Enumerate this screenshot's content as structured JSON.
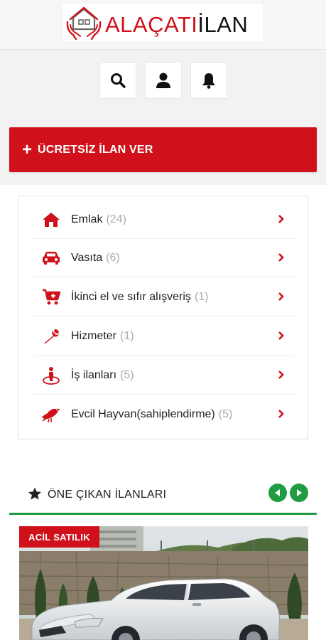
{
  "brand": {
    "part1": "ALAÇATI",
    "part2": "İLAN",
    "color_red": "#d0111b",
    "color_dark": "#111111"
  },
  "top_icons": [
    "search-icon",
    "user-icon",
    "bell-icon"
  ],
  "cta": {
    "label": "ÜCRETSİZ İLAN VER",
    "icon": "plus-icon",
    "color": "#d0111b"
  },
  "categories": [
    {
      "name": "Emlak",
      "count": "(24)",
      "icon": "home-icon"
    },
    {
      "name": "Vasıta",
      "count": "(6)",
      "icon": "car-icon"
    },
    {
      "name": "İkinci el ve sıfır alışveriş",
      "count": "(1)",
      "icon": "cart-icon"
    },
    {
      "name": "Hizmeter",
      "count": "(1)",
      "icon": "wrench-icon"
    },
    {
      "name": "İş ilanları",
      "count": "(5)",
      "icon": "person-pin-icon"
    },
    {
      "name": "Evcil Hayvan(sahiplendirme)",
      "count": "(5)",
      "icon": "bird-icon"
    }
  ],
  "featured": {
    "title": "ÖNE ÇIKAN İLANLARI",
    "accent": "#1f9c41"
  },
  "listing": {
    "badge": "ACİL SATILIK"
  }
}
